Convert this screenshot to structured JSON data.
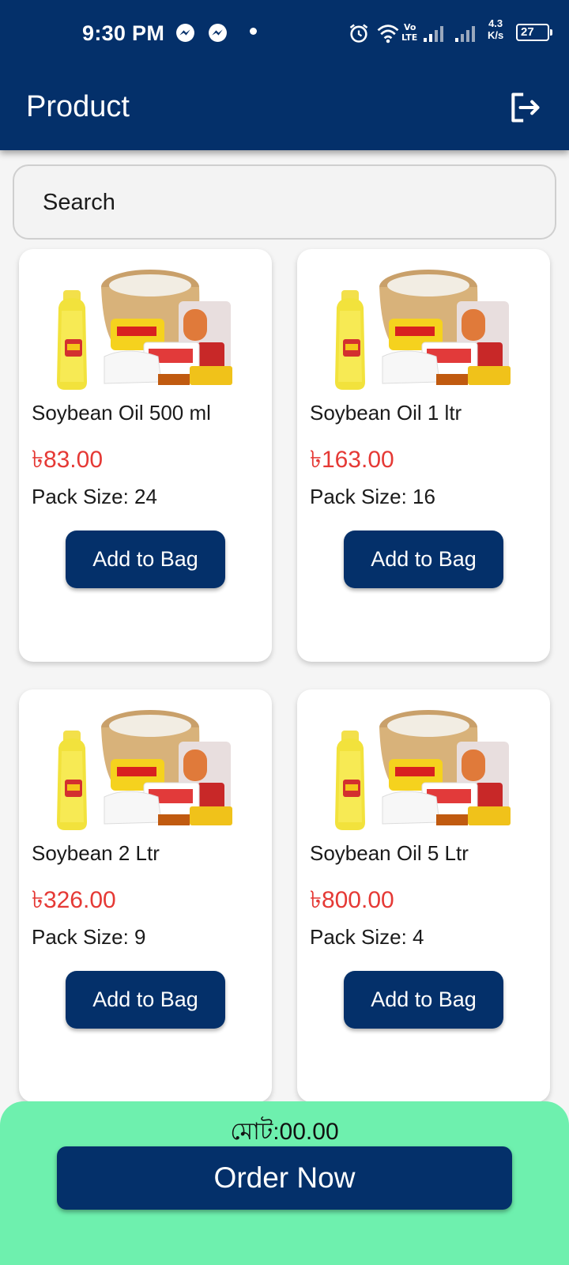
{
  "status_bar": {
    "time": "9:30 PM",
    "network_speed_value": "4.3",
    "network_speed_unit": "K/s",
    "battery": "27",
    "icons": [
      "messenger-icon",
      "messenger-icon",
      "alarm-icon",
      "wifi-icon",
      "volte-icon",
      "signal-icon",
      "signal-icon",
      "battery-icon"
    ]
  },
  "header": {
    "title": "Product",
    "action_icon": "logout-icon"
  },
  "search": {
    "placeholder": "Search"
  },
  "products": [
    {
      "name": "Soybean Oil 500 ml",
      "price": "৳83.00",
      "pack": "Pack Size: 24",
      "button": "Add to Bag"
    },
    {
      "name": "Soybean Oil 1 ltr",
      "price": "৳163.00",
      "pack": "Pack Size: 16",
      "button": "Add to Bag"
    },
    {
      "name": "Soybean 2 Ltr",
      "price": "৳326.00",
      "pack": "Pack Size: 9",
      "button": "Add to Bag"
    },
    {
      "name": "Soybean Oil 5 Ltr",
      "price": "৳800.00",
      "pack": "Pack Size: 4",
      "button": "Add to Bag"
    }
  ],
  "footer": {
    "total": "মোট:00.00",
    "order_button": "Order Now"
  },
  "colors": {
    "primary": "#04306a",
    "price": "#e53935",
    "footer_bg": "#6ef0ae",
    "card_bg": "#ffffff"
  }
}
